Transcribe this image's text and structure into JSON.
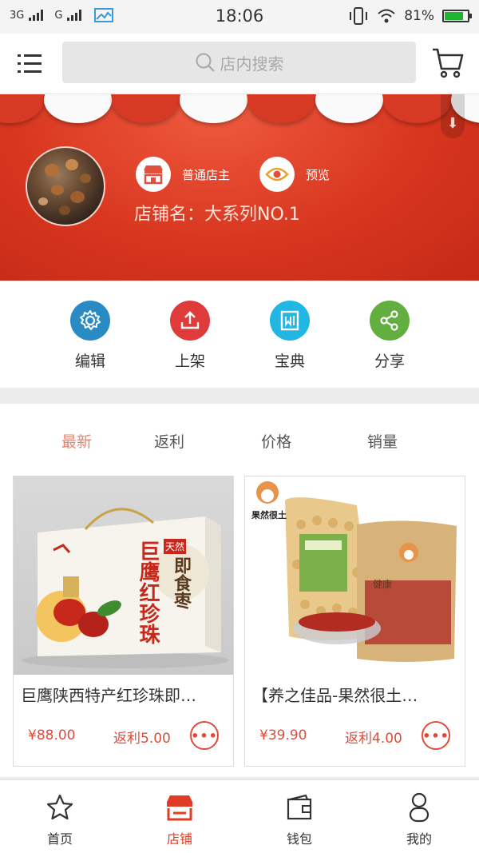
{
  "status_bar": {
    "network1": "3G",
    "network2": "G",
    "time": "18:06",
    "battery": "81%",
    "battery_level": 0.81
  },
  "header": {
    "search_placeholder": "店内搜索"
  },
  "shop": {
    "role_label": "普通店主",
    "preview_label": "预览",
    "store_name": "店铺名：大系列NO.1"
  },
  "actions": [
    {
      "label": "编辑",
      "icon": "gear-icon",
      "color": "#2a8bc4"
    },
    {
      "label": "上架",
      "icon": "upload-icon",
      "color": "#df3b3b"
    },
    {
      "label": "宝典",
      "icon": "book-icon",
      "color": "#22b6e3"
    },
    {
      "label": "分享",
      "icon": "share-icon",
      "color": "#62ae3f"
    }
  ],
  "sort_tabs": [
    {
      "label": "最新",
      "active": true
    },
    {
      "label": "返利",
      "active": false
    },
    {
      "label": "价格",
      "active": false
    },
    {
      "label": "销量",
      "active": false
    }
  ],
  "products": [
    {
      "title": "巨鹰陕西特产红珍珠即…",
      "price": "¥88.00",
      "rebate": "返利5.00",
      "box_text_1": "巨鹰红珍珠",
      "box_text_2": "即食枣",
      "box_text_3": "天然"
    },
    {
      "title": "【养之佳品-果然很土…",
      "price": "¥39.90",
      "rebate": "返利4.00",
      "brand": "果然很土",
      "pack_label": "健康"
    }
  ],
  "bottom_nav": [
    {
      "label": "首页",
      "active": false
    },
    {
      "label": "店铺",
      "active": true
    },
    {
      "label": "钱包",
      "active": false
    },
    {
      "label": "我的",
      "active": false
    }
  ],
  "colors": {
    "brand_red": "#d8361f",
    "accent": "#e03c24",
    "price": "#e04c3b"
  }
}
